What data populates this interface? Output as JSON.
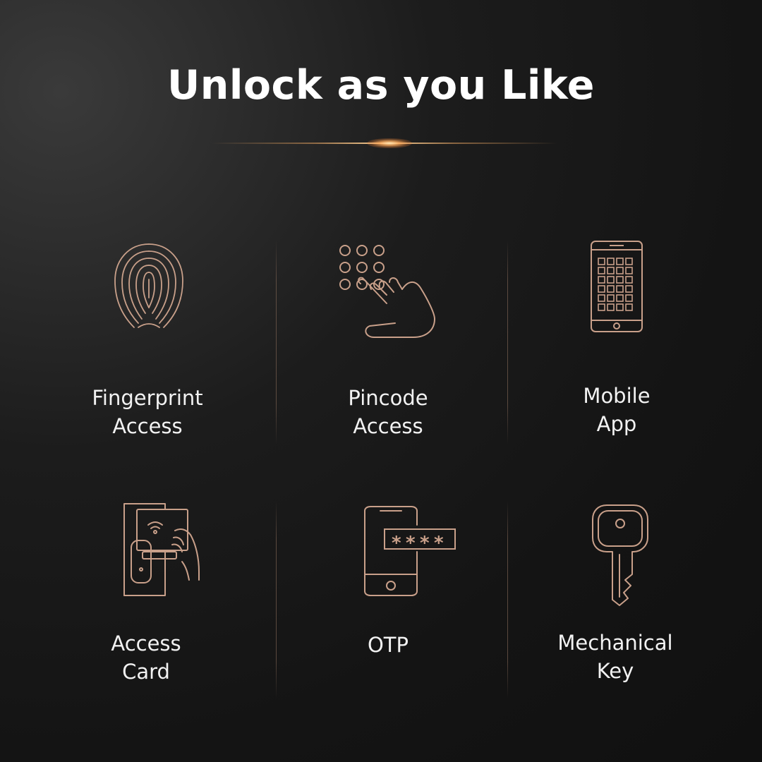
{
  "title": "Unlock as you Like",
  "accent_color": "#c9a08a",
  "options": [
    {
      "icon": "fingerprint-icon",
      "line1": "Fingerprint",
      "line2": "Access"
    },
    {
      "icon": "keypad-touch-icon",
      "line1": "Pincode",
      "line2": "Access"
    },
    {
      "icon": "mobile-app-icon",
      "line1": "Mobile",
      "line2": "App"
    },
    {
      "icon": "access-card-icon",
      "line1": "Access",
      "line2": "Card"
    },
    {
      "icon": "otp-phone-icon",
      "line1": "OTP",
      "line2": ""
    },
    {
      "icon": "mechanical-key-icon",
      "line1": "Mechanical",
      "line2": "Key"
    }
  ]
}
